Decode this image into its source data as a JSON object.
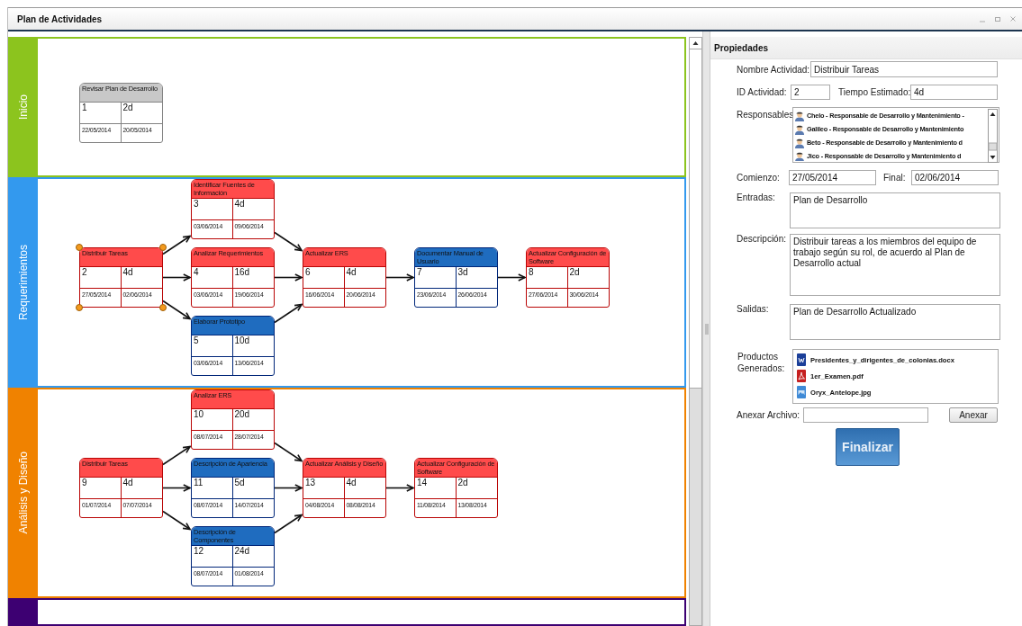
{
  "window": {
    "title": "Plan de Actividades"
  },
  "lanes": [
    {
      "label": "Inicio",
      "color": "#8cc41e",
      "columns": [
        [
          {
            "name": "Revisar Plan de Desarrollo",
            "id": "1",
            "duration": "2d",
            "start": "22/05/2014",
            "end": "20/05/2014",
            "color": "#c8c8c8",
            "selected": false
          }
        ]
      ]
    },
    {
      "label": "Requerimientos",
      "color": "#3399ee",
      "columns": [
        [
          {
            "name": "Distribuir Tareas",
            "id": "2",
            "duration": "4d",
            "start": "27/05/2014",
            "end": "02/06/2014",
            "color": "#ff4b4b",
            "selected": true
          }
        ],
        [
          {
            "name": "Identificar Fuentes de Información",
            "id": "3",
            "duration": "4d",
            "start": "03/06/2014",
            "end": "09/06/2014",
            "color": "#ff4b4b",
            "selected": false
          },
          {
            "name": "Analizar Requerimientos",
            "id": "4",
            "duration": "16d",
            "start": "03/06/2014",
            "end": "19/06/2014",
            "color": "#ff4b4b",
            "selected": false
          },
          {
            "name": "Elaborar Prototipo",
            "id": "5",
            "duration": "10d",
            "start": "03/06/2014",
            "end": "13/06/2014",
            "color": "#1f6cbf",
            "selected": false
          }
        ],
        [
          {
            "name": "Actualizar ERS",
            "id": "6",
            "duration": "4d",
            "start": "16/06/2014",
            "end": "20/06/2014",
            "color": "#ff4b4b",
            "selected": false
          }
        ],
        [
          {
            "name": "Documentar Manual de Usuario",
            "id": "7",
            "duration": "3d",
            "start": "23/06/2014",
            "end": "26/06/2014",
            "color": "#1f6cbf",
            "selected": false
          }
        ],
        [
          {
            "name": "Actualizar Configuración de Software",
            "id": "8",
            "duration": "2d",
            "start": "27/06/2014",
            "end": "30/06/2014",
            "color": "#ff4b4b",
            "selected": false
          }
        ]
      ]
    },
    {
      "label": "Análisis y Diseño",
      "color": "#f08200",
      "columns": [
        [
          {
            "name": "Distribuir Tareas",
            "id": "9",
            "duration": "4d",
            "start": "01/07/2014",
            "end": "07/07/2014",
            "color": "#ff4b4b",
            "selected": false
          }
        ],
        [
          {
            "name": "Analizar ERS",
            "id": "10",
            "duration": "20d",
            "start": "08/07/2014",
            "end": "28/07/2014",
            "color": "#ff4b4b",
            "selected": false
          },
          {
            "name": "Descripción de Apariencia",
            "id": "11",
            "duration": "5d",
            "start": "08/07/2014",
            "end": "14/07/2014",
            "color": "#1f6cbf",
            "selected": false
          },
          {
            "name": "Descripción de Componentes",
            "id": "12",
            "duration": "24d",
            "start": "08/07/2014",
            "end": "01/08/2014",
            "color": "#1f6cbf",
            "selected": false
          }
        ],
        [
          {
            "name": "Actualizar Análisis y Diseño",
            "id": "13",
            "duration": "4d",
            "start": "04/08/2014",
            "end": "08/08/2014",
            "color": "#ff4b4b",
            "selected": false
          }
        ],
        [
          {
            "name": "Actualizar Configuración de Software",
            "id": "14",
            "duration": "2d",
            "start": "11/08/2014",
            "end": "13/08/2014",
            "color": "#ff4b4b",
            "selected": false
          }
        ]
      ]
    },
    {
      "color": "#3d0072"
    }
  ],
  "properties": {
    "title": "Propiedades",
    "activity_name": {
      "label": "Nombre Actividad:",
      "value": "Distribuir Tareas"
    },
    "activity_id": {
      "label": "ID Actividad:",
      "value": "2"
    },
    "estimated_time": {
      "label": "Tiempo Estimado:",
      "value": "4d"
    },
    "responsibles": {
      "label": "Responsables",
      "items": [
        "Chelo - Responsable de Desarrollo y Mantenimiento -",
        "Galileo - Responsable de Desarrollo y Mantenimiento",
        "Beto - Responsable de Desarrollo y Mantenimiento d",
        "Jico - Responsable de Desarrollo y Mantenimiento d"
      ]
    },
    "start": {
      "label": "Comienzo:",
      "value": "27/05/2014"
    },
    "end": {
      "label": "Final:",
      "value": "02/06/2014"
    },
    "inputs": {
      "label": "Entradas:",
      "value": "Plan de Desarrollo"
    },
    "description": {
      "label": "Descripción:",
      "value": "Distribuir tareas a los miembros del equipo de trabajo según su rol, de acuerdo al Plan de Desarrollo actual"
    },
    "outputs": {
      "label": "Salidas:",
      "value": "Plan de Desarrollo Actualizado"
    },
    "products": {
      "label": "Productos Generados:",
      "items": [
        {
          "name": "Presidentes_y_dirigentes_de_colonias.docx",
          "kind": "word"
        },
        {
          "name": "1er_Examen.pdf",
          "kind": "pdf"
        },
        {
          "name": "Oryx_Antelope.jpg",
          "kind": "image"
        }
      ]
    },
    "attach": {
      "label": "Anexar Archivo:",
      "button": "Anexar"
    },
    "finish_button": "Finalizar"
  }
}
